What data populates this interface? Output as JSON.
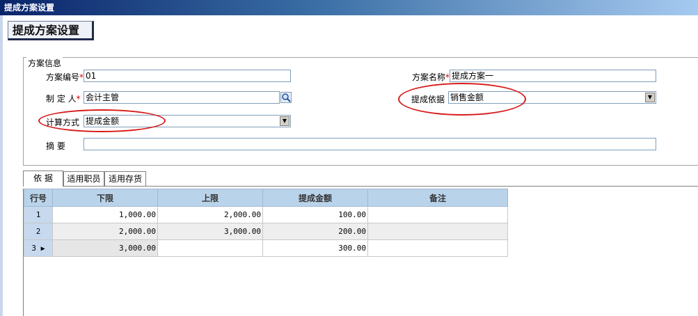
{
  "window": {
    "title": "提成方案设置"
  },
  "header": {
    "title": "提成方案设置"
  },
  "scheme_info": {
    "legend": "方案信息",
    "code_label": "方案编号",
    "code_value": "01",
    "name_label": "方案名称",
    "name_value": "提成方案一",
    "maker_label": "制 定 人",
    "maker_value": "会计主管",
    "basis_label": "提成依据",
    "basis_value": "销售金额",
    "calc_label": "计算方式",
    "calc_value": "提成金额",
    "summary_label": "摘    要",
    "summary_value": "",
    "required_mark": "*"
  },
  "tabs": [
    {
      "label": "依  据",
      "active": true
    },
    {
      "label": "适用职员",
      "active": false
    },
    {
      "label": "适用存货",
      "active": false
    }
  ],
  "grid": {
    "columns": [
      "行号",
      "下限",
      "上限",
      "提成金额",
      "备注"
    ],
    "rows": [
      {
        "no": "1",
        "lower": "1,000.00",
        "upper": "2,000.00",
        "amount": "100.00",
        "note": ""
      },
      {
        "no": "2",
        "lower": "2,000.00",
        "upper": "3,000.00",
        "amount": "200.00",
        "note": ""
      },
      {
        "no": "3",
        "lower": "3,000.00",
        "upper": "",
        "amount": "300.00",
        "note": ""
      }
    ]
  },
  "colors": {
    "annotation_oval": "#d81a1a",
    "grid_header": "#b9d3ea",
    "titlebar": "#0a246a"
  }
}
